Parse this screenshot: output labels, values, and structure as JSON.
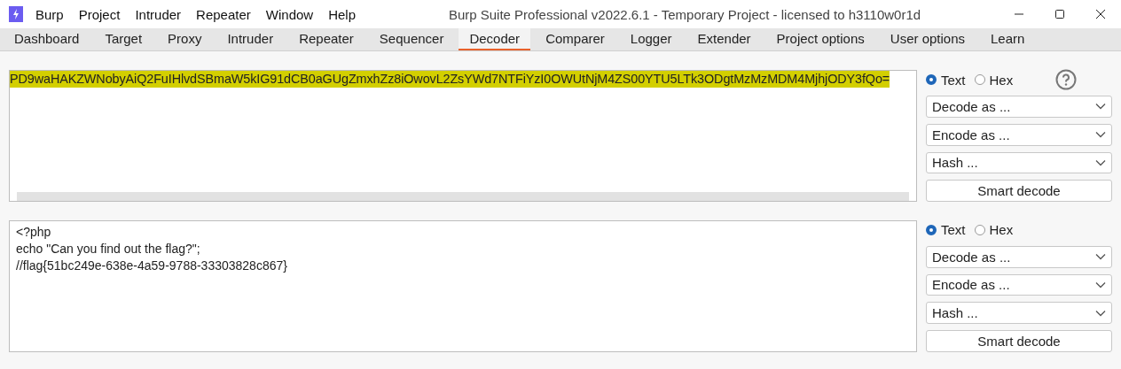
{
  "window": {
    "title": "Burp Suite Professional v2022.6.1 - Temporary Project - licensed to h3110w0r1d"
  },
  "menu": [
    "Burp",
    "Project",
    "Intruder",
    "Repeater",
    "Window",
    "Help"
  ],
  "tabs": [
    {
      "label": "Dashboard",
      "selected": false
    },
    {
      "label": "Target",
      "selected": false
    },
    {
      "label": "Proxy",
      "selected": false
    },
    {
      "label": "Intruder",
      "selected": false
    },
    {
      "label": "Repeater",
      "selected": false
    },
    {
      "label": "Sequencer",
      "selected": false
    },
    {
      "label": "Decoder",
      "selected": true
    },
    {
      "label": "Comparer",
      "selected": false
    },
    {
      "label": "Logger",
      "selected": false
    },
    {
      "label": "Extender",
      "selected": false
    },
    {
      "label": "Project options",
      "selected": false
    },
    {
      "label": "User options",
      "selected": false
    },
    {
      "label": "Learn",
      "selected": false
    }
  ],
  "panels": [
    {
      "kind": "input",
      "highlighted": true,
      "lines": [
        "PD9waHAKZWNobyAiQ2FuIHlvdSBmaW5kIG91dCB0aGUgZmxhZz8iOwovL2ZsYWd7NTFiYzI0OWUtNjM4ZS00YTU5LTk3ODgtMzMzMDM4MjhjODY3fQo="
      ],
      "format": [
        {
          "label": "Text",
          "selected": true
        },
        {
          "label": "Hex",
          "selected": false
        }
      ],
      "dropdowns": [
        "Decode as ...",
        "Encode as ...",
        "Hash ..."
      ],
      "button": "Smart decode"
    },
    {
      "kind": "output",
      "highlighted": false,
      "lines": [
        "<?php",
        "echo \"Can you find out the flag?\";",
        "//flag{51bc249e-638e-4a59-9788-33303828c867}"
      ],
      "format": [
        {
          "label": "Text",
          "selected": true
        },
        {
          "label": "Hex",
          "selected": false
        }
      ],
      "dropdowns": [
        "Decode as ...",
        "Encode as ...",
        "Hash ..."
      ],
      "button": "Smart decode"
    }
  ]
}
